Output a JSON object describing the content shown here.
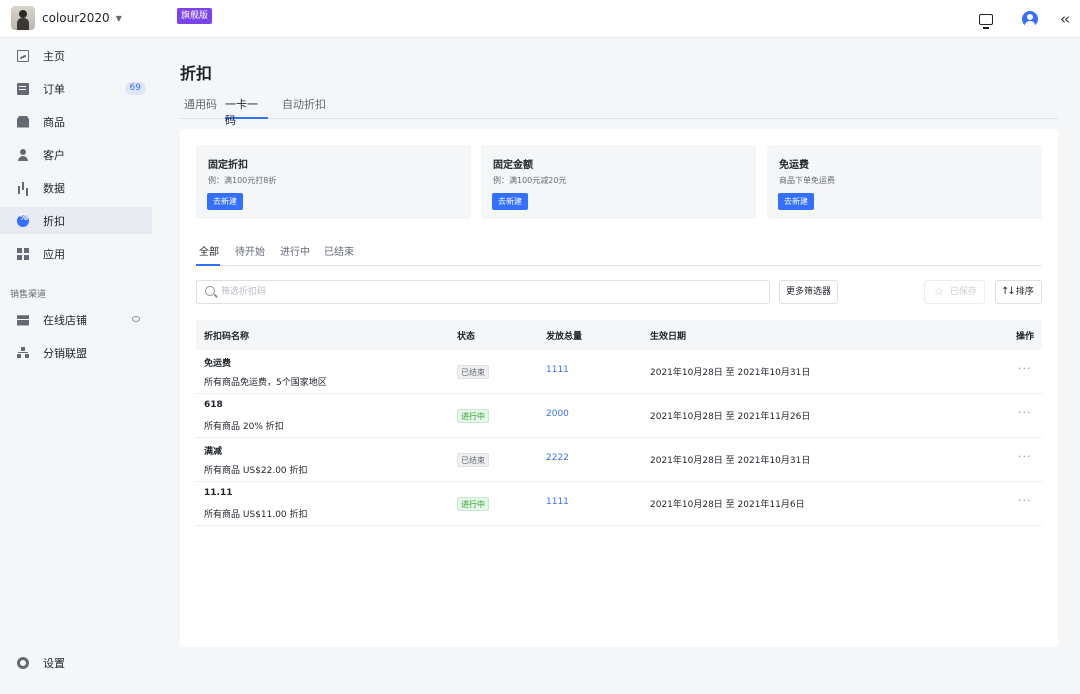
{
  "topbar": {
    "store_name": "colour2020",
    "plan_badge": "旗舰版"
  },
  "sidebar": {
    "items": [
      {
        "label": "主页",
        "icon": "home-chart-icon"
      },
      {
        "label": "订单",
        "icon": "order-icon",
        "count": "69"
      },
      {
        "label": "商品",
        "icon": "goods-icon"
      },
      {
        "label": "客户",
        "icon": "customer-icon"
      },
      {
        "label": "数据",
        "icon": "bar-chart-icon"
      },
      {
        "label": "折扣",
        "icon": "discount-icon",
        "active": true
      },
      {
        "label": "应用",
        "icon": "apps-grid-icon"
      }
    ],
    "section_label": "销售渠道",
    "channels": [
      {
        "label": "在线店铺",
        "icon": "store-icon"
      },
      {
        "label": "分销联盟",
        "icon": "affiliate-icon"
      }
    ],
    "settings_label": "设置"
  },
  "page": {
    "title": "折扣",
    "tabs": [
      "通用码",
      "一卡一码",
      "自动折扣"
    ],
    "active_tab": "一卡一码"
  },
  "promos": [
    {
      "title": "固定折扣",
      "desc": "例：满100元打8折",
      "button": "去新建"
    },
    {
      "title": "固定金额",
      "desc": "例：满100元减20元",
      "button": "去新建"
    },
    {
      "title": "免运费",
      "desc": "商品下单免运费",
      "button": "去新建"
    }
  ],
  "filters": {
    "tabs": [
      "全部",
      "待开始",
      "进行中",
      "已结束"
    ],
    "active_tab": "全部",
    "search_placeholder": "筛选折扣码",
    "more_filters": "更多筛选器",
    "saved": "已保存",
    "sort": "排序"
  },
  "table": {
    "columns": [
      "折扣码名称",
      "状态",
      "发放总量",
      "生效日期",
      "操作"
    ],
    "rows": [
      {
        "name": "免运费",
        "desc": "所有商品免运费，5个国家地区",
        "status": "已结束",
        "qty": "1111",
        "date": "2021年10月28日 至 2021年10月31日"
      },
      {
        "name": "618",
        "desc": "所有商品 20% 折扣",
        "status": "进行中",
        "qty": "2000",
        "date": "2021年10月28日 至 2021年11月26日"
      },
      {
        "name": "满减",
        "desc": "所有商品 US$22.00 折扣",
        "status": "已结束",
        "qty": "2222",
        "date": "2021年10月28日 至 2021年10月31日"
      },
      {
        "name": "11.11",
        "desc": "所有商品 US$11.00 折扣",
        "status": "进行中",
        "qty": "1111",
        "date": "2021年10月28日 至 2021年11月6日"
      }
    ],
    "more": "···"
  },
  "colors": {
    "accent": "#3370ff",
    "plan_badge": "#7b43e8",
    "status_active": "#2ea121",
    "status_ended": "#646a73"
  }
}
